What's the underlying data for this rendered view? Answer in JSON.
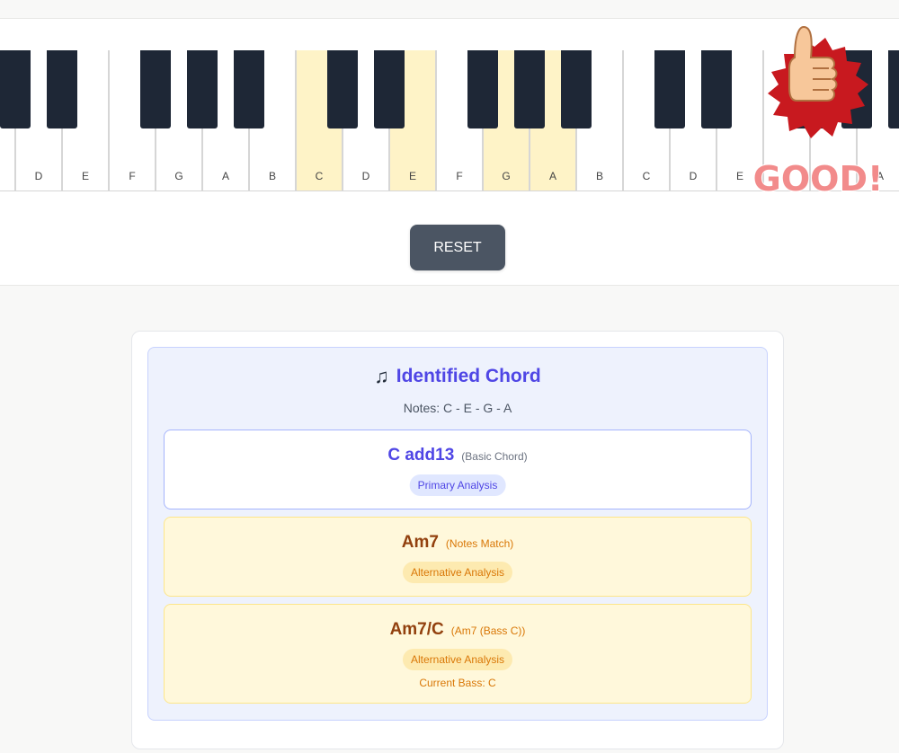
{
  "keyboard": {
    "white_keys": [
      {
        "label": "",
        "highlighted": false
      },
      {
        "label": "D",
        "highlighted": false
      },
      {
        "label": "E",
        "highlighted": false
      },
      {
        "label": "F",
        "highlighted": false
      },
      {
        "label": "G",
        "highlighted": false
      },
      {
        "label": "A",
        "highlighted": false
      },
      {
        "label": "B",
        "highlighted": false
      },
      {
        "label": "C",
        "highlighted": true
      },
      {
        "label": "D",
        "highlighted": false
      },
      {
        "label": "E",
        "highlighted": true
      },
      {
        "label": "F",
        "highlighted": false
      },
      {
        "label": "G",
        "highlighted": true
      },
      {
        "label": "A",
        "highlighted": true
      },
      {
        "label": "B",
        "highlighted": false
      },
      {
        "label": "C",
        "highlighted": false
      },
      {
        "label": "D",
        "highlighted": false
      },
      {
        "label": "E",
        "highlighted": false
      },
      {
        "label": "F",
        "highlighted": false
      },
      {
        "label": "G",
        "highlighted": false
      },
      {
        "label": "A",
        "highlighted": false
      }
    ],
    "highlight_color": "#fef3c7"
  },
  "reset": {
    "label": "RESET"
  },
  "sticker": {
    "text": "GOOD!",
    "icon": "thumbs-up-icon"
  },
  "result": {
    "icon": "♫",
    "title": "Identified Chord",
    "notes": "Notes: C - E - G - A",
    "primary": {
      "name": "C add13",
      "type": "(Basic Chord)",
      "badge": "Primary Analysis"
    },
    "alternatives": [
      {
        "name": "Am7",
        "type": "(Notes Match)",
        "badge": "Alternative Analysis",
        "extra": ""
      },
      {
        "name": "Am7/C",
        "type": "(Am7 (Bass C))",
        "badge": "Alternative Analysis",
        "extra": "Current Bass: C"
      }
    ]
  },
  "colors": {
    "accent": "#4f46e5",
    "alt_text": "#92400e",
    "alt_accent": "#d97706"
  }
}
